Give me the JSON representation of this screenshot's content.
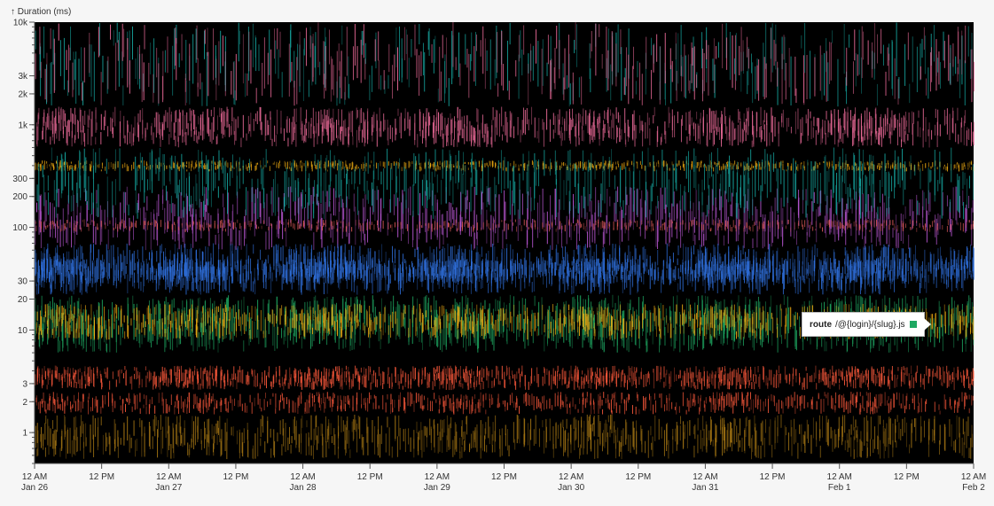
{
  "chart_data": {
    "type": "heatmap",
    "y_axis_title": "↑ Duration (ms)",
    "y_scale": "log",
    "ylim": [
      0.5,
      10000
    ],
    "y_ticks": [
      {
        "value": 10000,
        "label": "10k"
      },
      {
        "value": 3000,
        "label": "3k"
      },
      {
        "value": 2000,
        "label": "2k"
      },
      {
        "value": 1000,
        "label": "1k"
      },
      {
        "value": 300,
        "label": "300"
      },
      {
        "value": 200,
        "label": "200"
      },
      {
        "value": 100,
        "label": "100"
      },
      {
        "value": 30,
        "label": "30"
      },
      {
        "value": 20,
        "label": "20"
      },
      {
        "value": 10,
        "label": "10"
      },
      {
        "value": 3,
        "label": "3"
      },
      {
        "value": 2,
        "label": "2"
      },
      {
        "value": 1,
        "label": "1"
      }
    ],
    "xlim": [
      "Jan 26 12 AM",
      "Feb 2 12 AM"
    ],
    "x_ticks": [
      {
        "hours": 0,
        "label1": "12 AM",
        "label2": "Jan 26"
      },
      {
        "hours": 12,
        "label1": "12 PM",
        "label2": ""
      },
      {
        "hours": 24,
        "label1": "12 AM",
        "label2": "Jan 27"
      },
      {
        "hours": 36,
        "label1": "12 PM",
        "label2": ""
      },
      {
        "hours": 48,
        "label1": "12 AM",
        "label2": "Jan 28"
      },
      {
        "hours": 60,
        "label1": "12 PM",
        "label2": ""
      },
      {
        "hours": 72,
        "label1": "12 AM",
        "label2": "Jan 29"
      },
      {
        "hours": 84,
        "label1": "12 PM",
        "label2": ""
      },
      {
        "hours": 96,
        "label1": "12 AM",
        "label2": "Jan 30"
      },
      {
        "hours": 108,
        "label1": "12 PM",
        "label2": ""
      },
      {
        "hours": 120,
        "label1": "12 AM",
        "label2": "Jan 31"
      },
      {
        "hours": 132,
        "label1": "12 PM",
        "label2": ""
      },
      {
        "hours": 144,
        "label1": "12 AM",
        "label2": "Feb 1"
      },
      {
        "hours": 156,
        "label1": "12 PM",
        "label2": ""
      },
      {
        "hours": 168,
        "label1": "12 AM",
        "label2": "Feb 2"
      }
    ],
    "bands": [
      {
        "color": "#f06c9b",
        "y_from": 600,
        "y_to": 1500,
        "density": 0.75
      },
      {
        "color": "#f5b013",
        "y_from": 350,
        "y_to": 450,
        "density": 0.6
      },
      {
        "color": "#c05adb",
        "y_from": 60,
        "y_to": 250,
        "density": 0.35
      },
      {
        "color": "#e05a5a",
        "y_from": 90,
        "y_to": 120,
        "density": 0.3
      },
      {
        "color": "#2f6fdb",
        "y_from": 22,
        "y_to": 70,
        "density": 0.95
      },
      {
        "color": "#2f6fdb",
        "y_from": 28,
        "y_to": 50,
        "density": 1.0
      },
      {
        "color": "#1ea862",
        "y_from": 6,
        "y_to": 22,
        "density": 0.8
      },
      {
        "color": "#f5b013",
        "y_from": 8,
        "y_to": 18,
        "density": 0.7
      },
      {
        "color": "#ff5a3c",
        "y_from": 2.6,
        "y_to": 4.5,
        "density": 0.95
      },
      {
        "color": "#ff5a3c",
        "y_from": 1.5,
        "y_to": 2.5,
        "density": 0.5
      },
      {
        "color": "#a87814",
        "y_from": 0.55,
        "y_to": 1.5,
        "density": 0.55
      },
      {
        "color": "#16a6a0",
        "y_from": 120,
        "y_to": 600,
        "density": 0.25
      },
      {
        "color": "#16a6a0",
        "y_from": 1500,
        "y_to": 10000,
        "density": 0.04
      },
      {
        "color": "#f06c9b",
        "y_from": 1500,
        "y_to": 10000,
        "density": 0.03
      }
    ],
    "tooltip": {
      "key": "route",
      "value": "/@{login}/{slug}.js",
      "color": "#1ea862"
    }
  }
}
